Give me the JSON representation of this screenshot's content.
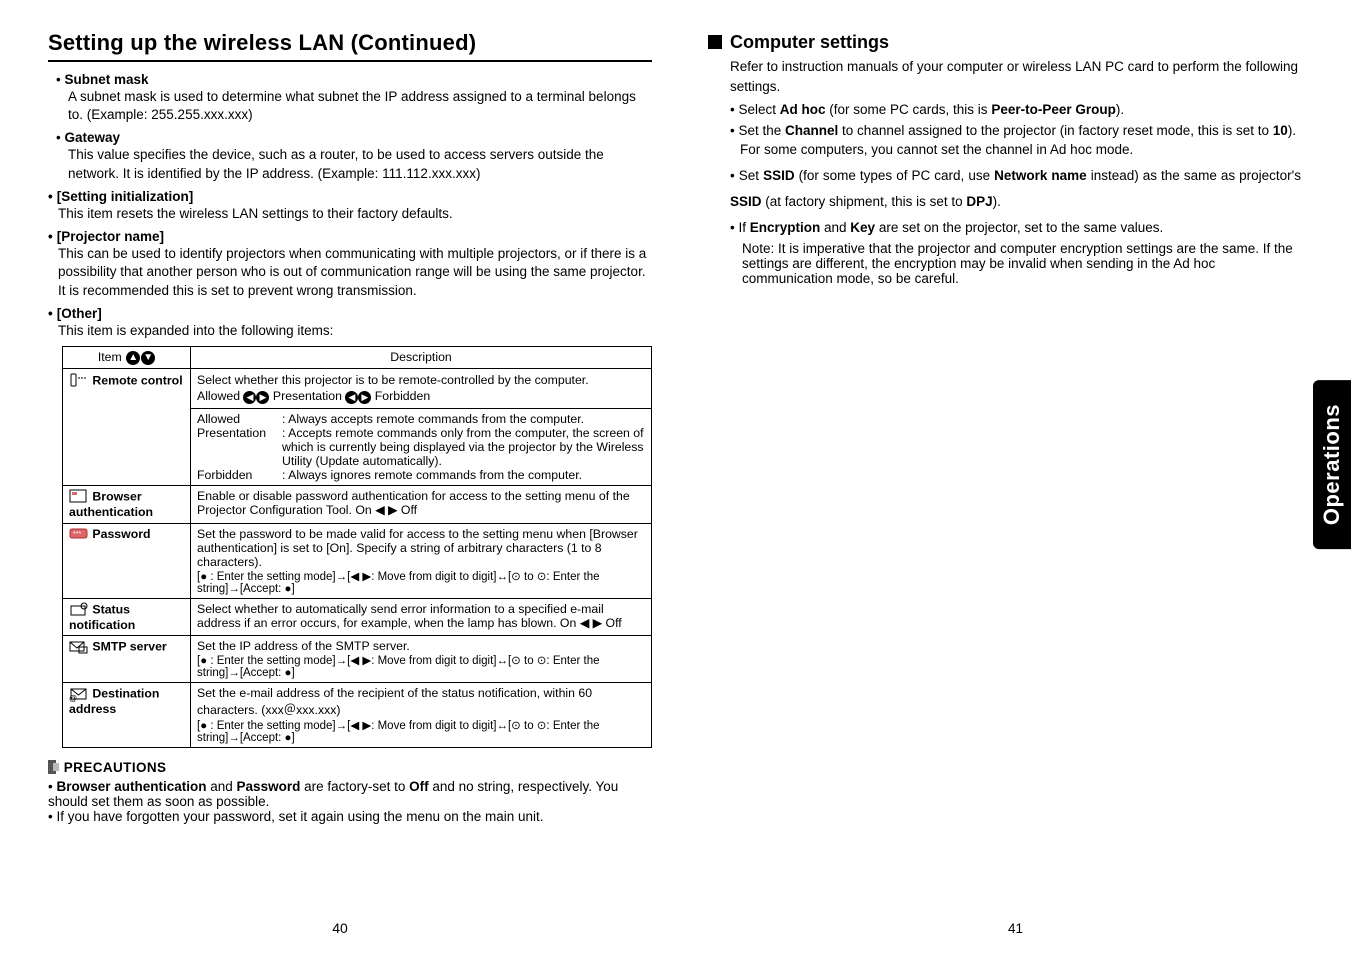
{
  "title": "Setting up the wireless LAN (Continued)",
  "left": {
    "subnet_label": "Subnet mask",
    "subnet_desc": "A subnet mask is used to determine what subnet the IP address assigned to a terminal belongs to. (Example: 255.255.xxx.xxx)",
    "gateway_label": "Gateway",
    "gateway_desc": "This value specifies the device, such as a router, to be used to access servers outside the network. It is identified by the IP address. (Example: 111.112.xxx.xxx)",
    "setting_init_label": "[Setting initialization]",
    "setting_init_desc": "This item resets the wireless LAN settings to their factory defaults.",
    "proj_name_label": "[Projector name]",
    "proj_name_desc": "This can be used to identify projectors when communicating with multiple projectors, or if there is a possibility that another person who is out of communication range will be using the same projector. It is recommended this is set to prevent wrong transmission.",
    "other_label": "[Other]",
    "other_desc": "This item is expanded into the following items:",
    "table": {
      "head_item": "Item",
      "head_desc": "Description",
      "rows": [
        {
          "label": "Remote control",
          "icon": "remote",
          "desc1": "Select whether this projector is to be remote-controlled by the computer.",
          "desc2": "Allowed ◀ ▶ Presentation ◀ ▶ Forbidden",
          "sub": {
            "allowed_k": "Allowed",
            "allowed_v": ": Always accepts remote commands from the computer.",
            "pres_k": "Presentation",
            "pres_v1": ": Accepts remote commands only from the computer, the screen of which is currently being displayed via the projector by the Wireless Utility (Update automatically).",
            "forb_k": "Forbidden",
            "forb_v": ": Always ignores remote commands from the computer."
          }
        },
        {
          "label": "Browser authentication",
          "icon": "browser",
          "desc": "Enable or disable password authentication for access to the setting menu of the Projector Configuration Tool.  On ◀ ▶ Off"
        },
        {
          "label": "Password",
          "icon": "password",
          "desc": "Set the password to be made valid for access to the setting menu when [Browser authentication] is set to [On].  Specify a string of arbitrary characters (1 to 8 characters).",
          "steps": "[● : Enter the setting mode]→[◀ ▶: Move from digit to digit]↔[⊙ to ⊙: Enter the string]→[Accept: ●]"
        },
        {
          "label": "Status notification",
          "icon": "status",
          "desc": "Select whether to automatically send error information to a specified e-mail address if an error occurs, for example, when the lamp has blown.  On ◀ ▶ Off"
        },
        {
          "label": "SMTP server",
          "icon": "smtp",
          "desc": "Set the IP address of the SMTP server.",
          "steps": "[● : Enter the setting mode]→[◀ ▶: Move from digit to digit]↔[⊙ to ⊙: Enter the string]→[Accept: ●]"
        },
        {
          "label": "Destination address",
          "icon": "dest",
          "desc": "Set the e-mail address of the recipient of the status notification, within 60 characters.  (xxx＠xxx.xxx)",
          "steps": "[● : Enter the setting mode]→[◀ ▶: Move from digit to digit]↔[⊙ to ⊙: Enter the string]→[Accept: ●]"
        }
      ]
    },
    "precautions_title": "PRECAUTIONS",
    "prec1": "Browser authentication and Password are factory-set to Off and no string, respectively. You should set them as soon as possible.",
    "prec1_bold1": "Browser authentication",
    "prec1_mid": " and ",
    "prec1_bold2": "Password",
    "prec1_mid2": " are factory-set to ",
    "prec1_bold3": "Off",
    "prec1_tail": " and no string, respectively. You should set them as soon as possible.",
    "prec2": "If you have forgotten your password, set it again using the menu on the main unit.",
    "page_num": "40"
  },
  "right": {
    "section_title": "Computer settings",
    "intro": "Refer to instruction manuals of your computer or wireless LAN PC card to perform the following settings.",
    "b1_pre": "Select ",
    "b1_bold1": "Ad hoc",
    "b1_mid": " (for some PC cards, this is ",
    "b1_bold2": "Peer-to-Peer Group",
    "b1_tail": ").",
    "b2_pre": "Set the ",
    "b2_bold1": "Channel",
    "b2_mid": " to channel assigned to the projector (in factory reset mode, this is set to ",
    "b2_bold2": "10",
    "b2_tail": ").",
    "b2_note": "For some computers, you cannot set the channel in Ad hoc mode.",
    "b3_pre": "Set ",
    "b3_bold1": "SSID",
    "b3_mid1": " (for some types of PC card, use ",
    "b3_bold2": "Network name",
    "b3_mid2": " instead) as the same as projector's ",
    "b3_bold3": "SSID",
    "b3_mid3": " (at factory shipment, this is set to ",
    "b3_bold4": "DPJ",
    "b3_tail": ").",
    "b4_pre": "If ",
    "b4_bold1": "Encryption",
    "b4_mid": " and ",
    "b4_bold2": "Key",
    "b4_tail": " are set on the projector, set to the same values.",
    "note_label": "Note:",
    "note_text": " It is imperative that the projector and computer encryption settings are the same. If the settings are different, the encryption may be invalid when sending in the Ad hoc communication mode, so be careful.",
    "operations_tab": "Operations",
    "page_num": "41"
  }
}
